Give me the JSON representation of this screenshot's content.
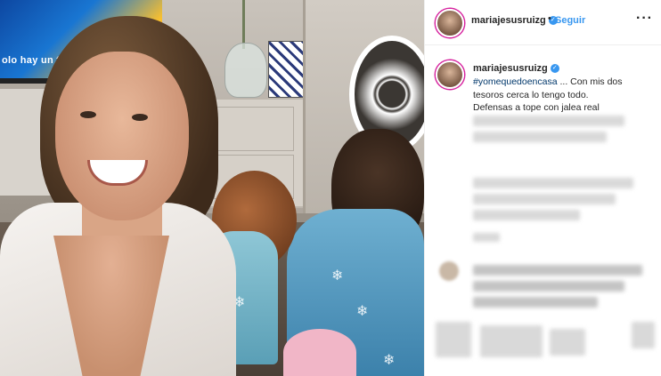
{
  "photo": {
    "tv_caption": "olo hay un tr"
  },
  "header": {
    "username": "mariajesusruizg",
    "verified_symbol": "✓",
    "separator": "•",
    "follow_label": "Seguir",
    "more_symbol": "···"
  },
  "caption": {
    "username": "mariajesusruizg",
    "verified_symbol": "✓",
    "hashtag": "#yomequedoencasa",
    "text_line1_rest": " ... Con mis dos",
    "text_line2": "tesoros cerca lo tengo todo.",
    "text_line3": "Defensas a tope con jalea real"
  },
  "icons": {
    "verified": "verified-badge-icon",
    "more": "more-options-icon"
  },
  "colors": {
    "link_blue": "#3897f0",
    "hashtag_blue": "#00376b",
    "ring_gradient": "#d6249f"
  }
}
